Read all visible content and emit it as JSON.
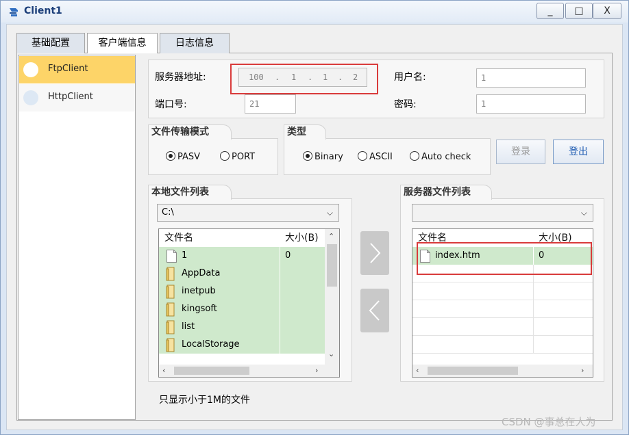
{
  "window": {
    "title": "Client1",
    "controls": {
      "minimize": "_",
      "maximize": "□",
      "close": "X"
    }
  },
  "tabs": [
    {
      "label": "基础配置"
    },
    {
      "label": "客户端信息",
      "active": true
    },
    {
      "label": "日志信息"
    }
  ],
  "client_types": [
    {
      "label": "FtpClient",
      "selected": true
    },
    {
      "label": "HttpClient"
    }
  ],
  "server_address": {
    "label": "服务器地址:",
    "octets": [
      "100",
      "1",
      "1",
      "2"
    ],
    "separator": "."
  },
  "port": {
    "label": "端口号:",
    "value": "21"
  },
  "username": {
    "label": "用户名:",
    "value": "1"
  },
  "password": {
    "label": "密码:",
    "value": "1"
  },
  "transfer_mode": {
    "title": "文件传输模式",
    "options": [
      "PASV",
      "PORT"
    ],
    "selected": "PASV"
  },
  "type": {
    "title": "类型",
    "options": [
      "Binary",
      "ASCII",
      "Auto check"
    ],
    "selected": "Binary"
  },
  "buttons": {
    "login": "登录",
    "logout": "登出"
  },
  "local_files": {
    "title": "本地文件列表",
    "path": "C:\\",
    "columns": [
      "文件名",
      "大小(B)"
    ],
    "rows": [
      {
        "name": "1",
        "size": "0",
        "kind": "file"
      },
      {
        "name": "AppData",
        "size": "",
        "kind": "folder"
      },
      {
        "name": "inetpub",
        "size": "",
        "kind": "folder"
      },
      {
        "name": "kingsoft",
        "size": "",
        "kind": "folder"
      },
      {
        "name": "list",
        "size": "",
        "kind": "folder"
      },
      {
        "name": "LocalStorage",
        "size": "",
        "kind": "folder"
      }
    ]
  },
  "server_files": {
    "title": "服务器文件列表",
    "path": "",
    "columns": [
      "文件名",
      "大小(B)"
    ],
    "rows": [
      {
        "name": "index.htm",
        "size": "0",
        "kind": "file"
      }
    ]
  },
  "transfer_buttons": {
    "upload": ">",
    "download": "<"
  },
  "footer_note": "只显示小于1M的文件",
  "watermark": "CSDN @事总在人为",
  "colors": {
    "selection_yellow": "#fdd468",
    "row_green": "#cfe9cc",
    "highlight_red": "#d93b3b",
    "title_blue": "#1c3f7a"
  }
}
